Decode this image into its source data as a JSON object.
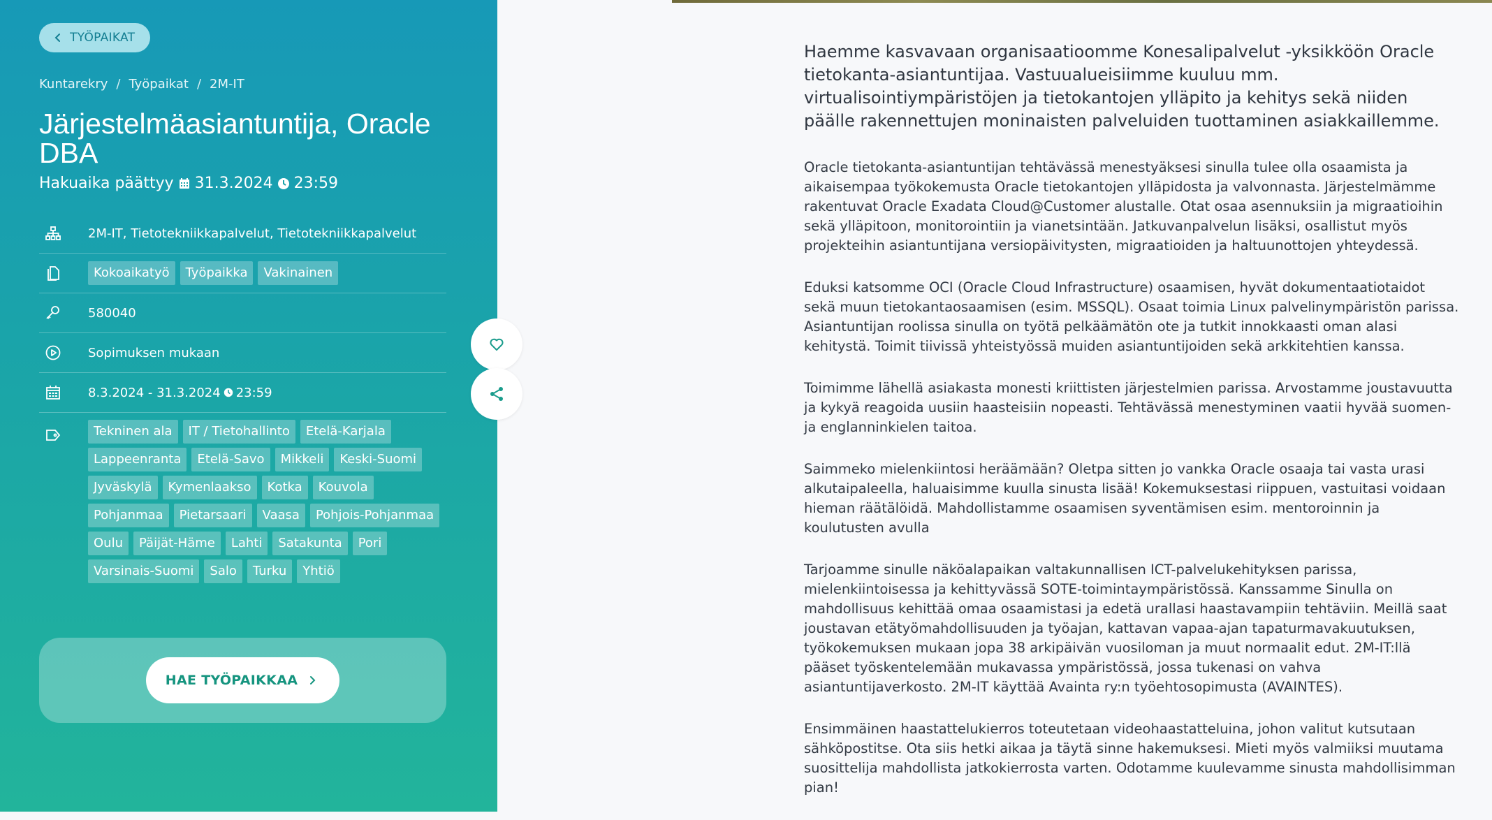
{
  "nav": {
    "back_label": "TYÖPAIKAT"
  },
  "breadcrumb": [
    "Kuntarekry",
    "Työpaikat",
    "2M-IT"
  ],
  "job": {
    "title": "Järjestelmäasiantuntija, Oracle DBA",
    "deadline_label": "Hakuaika päättyy",
    "deadline_date": "31.3.2024",
    "deadline_time": "23:59"
  },
  "info": {
    "organization": "2M-IT, Tietotekniikkapalvelut, Tietotekniikkapalvelut",
    "employment_tags": [
      "Kokoaikatyö",
      "Työpaikka",
      "Vakinainen"
    ],
    "job_id": "580040",
    "salary": "Sopimuksen mukaan",
    "period": "8.3.2024 - 31.3.2024",
    "period_time": "23:59",
    "category_tags": [
      "Tekninen ala",
      "IT / Tietohallinto",
      "Etelä-Karjala",
      "Lappeenranta",
      "Etelä-Savo",
      "Mikkeli",
      "Keski-Suomi",
      "Jyväskylä",
      "Kymenlaakso",
      "Kotka",
      "Kouvola",
      "Pohjanmaa",
      "Pietarsaari",
      "Vaasa",
      "Pohjois-Pohjanmaa",
      "Oulu",
      "Päijät-Häme",
      "Lahti",
      "Satakunta",
      "Pori",
      "Varsinais-Suomi",
      "Salo",
      "Turku",
      "Yhtiö"
    ]
  },
  "apply": {
    "label": "HAE TYÖPAIKKAA"
  },
  "icons": {
    "back": "chevron-left-icon",
    "calendar": "calendar-icon",
    "clock": "clock-icon",
    "org": "sitemap-icon",
    "doc": "document-icon",
    "key": "key-icon",
    "salary": "play-circle-icon",
    "period": "calendar-icon",
    "tags": "tag-icon",
    "favorite": "heart-icon",
    "share": "share-icon"
  },
  "colors": {
    "panel_top": "#1799b7",
    "panel_bottom": "#22b49b",
    "accent_green": "#15947f"
  },
  "description": {
    "lead": "Haemme kasvavaan organisaatioomme Konesalipalvelut -yksikköön Oracle tietokanta-asiantuntijaa. Vastuualueisiimme kuuluu mm. virtualisointiympäristöjen ja tietokantojen ylläpito ja kehitys sekä niiden päälle rakennettujen moninaisten palveluiden tuottaminen asiakkaillemme.",
    "paragraphs": [
      "Oracle tietokanta-asiantuntijan tehtävässä menestyäksesi sinulla tulee olla osaamista ja aikaisempaa työkokemusta Oracle tietokantojen ylläpidosta ja valvonnasta. Järjestelmämme rakentuvat Oracle Exadata Cloud@Customer alustalle. Otat osaa asennuksiin ja migraatioihin sekä ylläpitoon, monitorointiin ja vianetsintään. Jatkuvanpalvelun lisäksi, osallistut myös projekteihin asiantuntijana versiopäivitysten, migraatioiden ja haltuunottojen yhteydessä.",
      "Eduksi katsomme OCI (Oracle Cloud Infrastructure) osaamisen, hyvät dokumentaatiotaidot sekä muun tietokantaosaamisen (esim. MSSQL). Osaat toimia Linux palvelinympäristön parissa. Asiantuntijan roolissa sinulla on työtä pelkäämätön ote ja tutkit innokkaasti oman alasi kehitystä. Toimit tiivissä yhteistyössä muiden asiantuntijoiden sekä arkkitehtien kanssa.",
      "Toimimme lähellä asiakasta monesti kriittisten järjestelmien parissa. Arvostamme joustavuutta ja kykyä reagoida uusiin haasteisiin nopeasti. Tehtävässä menestyminen vaatii hyvää suomen- ja englanninkielen taitoa.",
      "Saimmeko mielenkiintosi heräämään? Oletpa sitten jo vankka Oracle osaaja tai vasta urasi alkutaipaleella, haluaisimme kuulla sinusta lisää! Kokemuksestasi riippuen, vastuitasi voidaan hieman räätälöidä. Mahdollistamme osaamisen syventämisen esim. mentoroinnin ja koulutusten avulla",
      "Tarjoamme sinulle näköalapaikan valtakunnallisen ICT-palvelukehityksen parissa, mielenkiintoisessa ja kehittyvässä SOTE-toimintaympäristössä. Kanssamme Sinulla on mahdollisuus kehittää omaa osaamistasi ja edetä urallasi haastavampiin tehtäviin. Meillä saat joustavan etätyömahdollisuuden ja työajan, kattavan vapaa-ajan tapaturmavakuutuksen, työkokemuksen mukaan jopa 38 arkipäivän vuosiloman ja muut normaalit edut. 2M-IT:llä pääset työskentelemään mukavassa ympäristössä, jossa tukenasi on vahva asiantuntijaverkosto. 2M-IT käyttää Avainta ry:n työehtosopimusta (AVAINTES).",
      "Ensimmäinen haastattelukierros toteutetaan videohaastatteluina, johon valitut kutsutaan sähköpostitse. Ota siis hetki aikaa ja täytä sinne hakemuksesi. Mieti myös valmiiksi muutama suosittelija mahdollista jatkokierrosta varten. Odotamme kuulevamme sinusta mahdollisimman pian!"
    ]
  }
}
